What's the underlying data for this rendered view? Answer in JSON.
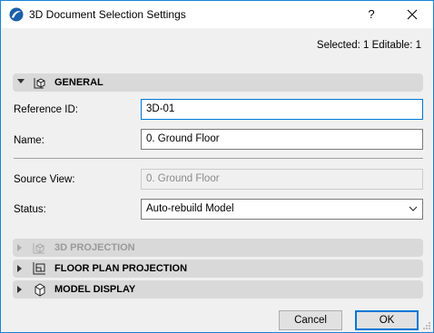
{
  "window": {
    "title": "3D Document Selection Settings",
    "help_label": "?",
    "accent": "#1883d7"
  },
  "selection": {
    "info": "Selected: 1 Editable: 1"
  },
  "sections": {
    "general": {
      "label": "GENERAL",
      "expanded": true,
      "icon": "document-cube-icon"
    },
    "projection": {
      "label": "3D PROJECTION",
      "expanded": false,
      "disabled": true,
      "icon": "projection-icon"
    },
    "floor_plan": {
      "label": "FLOOR PLAN PROJECTION",
      "expanded": false,
      "icon": "floor-plan-icon"
    },
    "model_display": {
      "label": "MODEL DISPLAY",
      "expanded": false,
      "icon": "cube-icon"
    }
  },
  "fields": {
    "reference_id": {
      "label": "Reference ID:",
      "value": "3D-01"
    },
    "name": {
      "label": "Name:",
      "value": "0. Ground Floor"
    },
    "source_view": {
      "label": "Source View:",
      "value": "0. Ground Floor"
    },
    "status": {
      "label": "Status:",
      "value": "Auto-rebuild Model"
    }
  },
  "buttons": {
    "cancel": "Cancel",
    "ok": "OK"
  }
}
